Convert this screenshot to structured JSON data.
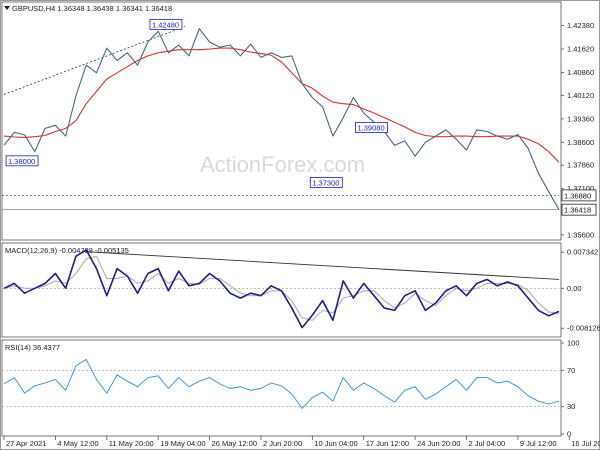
{
  "chart_data": [
    {
      "panel": "price",
      "type": "line",
      "title": "GBPUSD,H4 1.36348 1.36438 1.36341 1.36418",
      "symbol": "GBPUSD",
      "timeframe": "H4",
      "ohlc_header": [
        1.36348,
        1.36438,
        1.36341,
        1.36418
      ],
      "ylim": [
        1.355,
        1.4295
      ],
      "y_ticks": [
        "1.42380",
        "1.41620",
        "1.40860",
        "1.40120",
        "1.39360",
        "1.38600",
        "1.37860",
        "1.37100",
        "1.36320",
        "1.35600"
      ],
      "x": [
        0,
        5,
        10,
        15,
        20,
        25,
        30,
        35,
        40,
        45,
        50,
        55,
        60,
        65,
        70,
        75,
        80,
        85,
        90,
        95,
        100,
        105,
        110,
        115,
        120,
        125,
        130,
        135,
        140,
        145,
        150,
        155,
        160,
        165,
        170,
        175,
        180,
        185,
        190,
        195,
        200,
        205,
        210,
        215,
        220,
        225,
        230,
        235,
        240,
        245,
        250,
        255,
        260,
        265,
        270
      ],
      "series": [
        {
          "label": "close",
          "color": "#486a82",
          "values": [
            1.385,
            1.3892,
            1.3884,
            1.383,
            1.3905,
            1.3915,
            1.388,
            1.401,
            1.411,
            1.4085,
            1.4165,
            1.4125,
            1.415,
            1.411,
            1.4185,
            1.422,
            1.415,
            1.4175,
            1.414,
            1.4228,
            1.4185,
            1.4168,
            1.4175,
            1.414,
            1.4178,
            1.4135,
            1.415,
            1.4135,
            1.414,
            1.405,
            1.4005,
            1.3975,
            1.388,
            1.394,
            1.4005,
            1.3955,
            1.3925,
            1.3895,
            1.385,
            1.3865,
            1.3815,
            1.386,
            1.388,
            1.39,
            1.387,
            1.3835,
            1.39,
            1.3895,
            1.388,
            1.387,
            1.3885,
            1.384,
            1.376,
            1.37,
            1.3642
          ]
        },
        {
          "label": "moving average",
          "color": "#e03030",
          "values": [
            1.388,
            1.3877,
            1.3876,
            1.3878,
            1.3882,
            1.3895,
            1.3905,
            1.393,
            1.3985,
            1.4025,
            1.4065,
            1.4085,
            1.4105,
            1.4125,
            1.414,
            1.415,
            1.4155,
            1.416,
            1.416,
            1.416,
            1.4162,
            1.4165,
            1.4165,
            1.416,
            1.4152,
            1.4148,
            1.4142,
            1.412,
            1.4085,
            1.405,
            1.4035,
            1.401,
            1.399,
            1.3985,
            1.3982,
            1.3968,
            1.3955,
            1.394,
            1.3925,
            1.391,
            1.3892,
            1.3882,
            1.3878,
            1.3878,
            1.388,
            1.388,
            1.3878,
            1.3878,
            1.388,
            1.388,
            1.388,
            1.387,
            1.3855,
            1.383,
            1.3795
          ]
        }
      ],
      "trendline": {
        "x": [
          0,
          88
        ],
        "y": [
          1.4015,
          1.4235
        ],
        "style": "dotted"
      },
      "hlines": [
        {
          "y": 1.3688
        },
        {
          "y": 1.36418
        }
      ],
      "annotations": [
        {
          "text": "1.42480",
          "x": 71,
          "y": 1.4242
        },
        {
          "text": "1.38000",
          "x": 1,
          "y": 1.38
        },
        {
          "text": "1.37300",
          "x": 149,
          "y": 1.373
        },
        {
          "text": "1.39080",
          "x": 171,
          "y": 1.3908
        }
      ],
      "price_tags": [
        {
          "text": "1.36880",
          "y": 1.3688
        },
        {
          "text": "1.36418",
          "y": 1.36418
        }
      ],
      "watermark": "ActionForex.com"
    },
    {
      "panel": "macd",
      "type": "line",
      "title": "MACD(12,26,9) -0.004738 -0.005135",
      "ylim": [
        -0.0095,
        0.0084
      ],
      "y_ticks": [
        "0.007342",
        "0.00",
        "-0.008126"
      ],
      "x": [
        0,
        5,
        10,
        15,
        20,
        25,
        30,
        35,
        40,
        45,
        50,
        55,
        60,
        65,
        70,
        75,
        80,
        85,
        90,
        95,
        100,
        105,
        110,
        115,
        120,
        125,
        130,
        135,
        140,
        145,
        150,
        155,
        160,
        165,
        170,
        175,
        180,
        185,
        190,
        195,
        200,
        205,
        210,
        215,
        220,
        225,
        230,
        235,
        240,
        245,
        250,
        255,
        260,
        265,
        270
      ],
      "series": [
        {
          "label": "main",
          "color": "#1f1f8f",
          "values": [
            0.0,
            0.001,
            -0.001,
            0.0,
            0.001,
            0.003,
            0.0,
            0.0065,
            0.0078,
            0.004,
            -0.0015,
            0.004,
            0.0025,
            -0.001,
            0.003,
            0.004,
            -0.0005,
            0.0035,
            0.0005,
            0.001,
            0.003,
            0.0015,
            -0.001,
            -0.002,
            -0.001,
            -0.0015,
            0.0005,
            -0.0005,
            -0.004,
            -0.008,
            -0.0055,
            -0.0025,
            -0.0065,
            0.0015,
            -0.002,
            0.001,
            -0.0015,
            -0.004,
            -0.0045,
            -0.0015,
            -0.0005,
            -0.0045,
            -0.003,
            -0.0005,
            0.0005,
            -0.0015,
            0.001,
            0.0018,
            0.0005,
            0.0013,
            0.0005,
            -0.002,
            -0.0045,
            -0.0056,
            -0.0047
          ]
        },
        {
          "label": "signal",
          "color": "#b0b0b0",
          "values": [
            0.0,
            0.0005,
            0.0,
            0.0,
            0.0005,
            0.0015,
            0.001,
            0.003,
            0.006,
            0.0065,
            0.002,
            0.002,
            0.0025,
            0.001,
            0.0015,
            0.003,
            0.001,
            0.002,
            0.001,
            0.0008,
            0.002,
            0.002,
            0.0005,
            -0.001,
            -0.0015,
            -0.0015,
            -0.0005,
            -0.0005,
            -0.0025,
            -0.006,
            -0.0065,
            -0.0045,
            -0.005,
            -0.002,
            -0.0015,
            -0.0005,
            -0.0005,
            -0.0025,
            -0.004,
            -0.003,
            -0.001,
            -0.0025,
            -0.0035,
            -0.0015,
            0.0,
            -0.0005,
            0.0,
            0.001,
            0.001,
            0.001,
            0.0008,
            -0.0005,
            -0.003,
            -0.0048,
            -0.0051
          ]
        }
      ],
      "trendline": {
        "x": [
          38,
          270
        ],
        "y": [
          0.0075,
          0.0018
        ]
      }
    },
    {
      "panel": "rsi",
      "type": "line",
      "title": "RSI(14) 36.4377",
      "ylim": [
        0,
        100
      ],
      "y_ticks": [
        "100",
        "70",
        "30",
        "0"
      ],
      "levels": [
        70,
        30
      ],
      "x": [
        0,
        5,
        10,
        15,
        20,
        25,
        30,
        35,
        40,
        45,
        50,
        55,
        60,
        65,
        70,
        75,
        80,
        85,
        90,
        95,
        100,
        105,
        110,
        115,
        120,
        125,
        130,
        135,
        140,
        145,
        150,
        155,
        160,
        165,
        170,
        175,
        180,
        185,
        190,
        195,
        200,
        205,
        210,
        215,
        220,
        225,
        230,
        235,
        240,
        245,
        250,
        255,
        260,
        265,
        270
      ],
      "series": [
        {
          "label": "RSI",
          "color": "#2f8fe0",
          "values": [
            55,
            62,
            45,
            53,
            56,
            60,
            48,
            75,
            82,
            60,
            45,
            65,
            58,
            52,
            62,
            64,
            50,
            62,
            52,
            58,
            62,
            55,
            50,
            52,
            48,
            50,
            56,
            53,
            44,
            28,
            40,
            46,
            36,
            62,
            48,
            56,
            50,
            42,
            35,
            48,
            52,
            38,
            44,
            52,
            60,
            48,
            62,
            62,
            56,
            58,
            52,
            42,
            36,
            33,
            36
          ]
        }
      ]
    }
  ],
  "x_axis_labels": [
    "27 Apr 2021",
    "4 May 12:00",
    "11 May 20:00",
    "19 May 04:00",
    "26 May 12:00",
    "2 Jun 20:00",
    "10 Jun 04:00",
    "17 Jun 12:00",
    "24 Jun 20:00",
    "2 Jul 04:00",
    "9 Jul 12:00",
    "16 Jul 20:00"
  ],
  "x_axis_positions": [
    0,
    25,
    50,
    75,
    100,
    125,
    150,
    175,
    200,
    225,
    250,
    275
  ],
  "colors": {
    "price": "#486a82",
    "ma": "#e03030",
    "macd": "#1f1f8f",
    "signal": "#b0b0b0",
    "rsi": "#2f8fe0",
    "label_border": "#1f1fbf",
    "grid": "#c8c8c8"
  }
}
